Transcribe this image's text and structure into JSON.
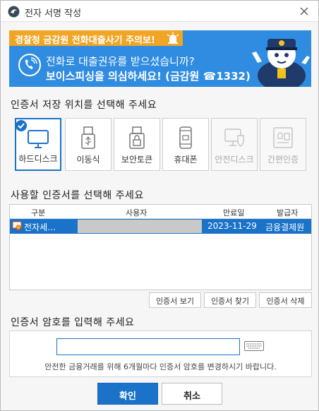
{
  "window": {
    "title": "전자 서명 작성"
  },
  "banner": {
    "alert": "경찰청 금감원 전화대출사기 주의보!",
    "line1": "전화로 대출권유를 받으셨습니까?",
    "line2": "보이스피싱을 의심하세요! (금감원 ☎1332)"
  },
  "storage": {
    "title": "인증서 저장 위치를 선택해 주세요",
    "items": [
      {
        "label": "하드디스크",
        "icon": "monitor-icon",
        "state": "selected"
      },
      {
        "label": "이동식",
        "icon": "usb-icon",
        "state": "enabled"
      },
      {
        "label": "보안토큰",
        "icon": "lock-token-icon",
        "state": "enabled"
      },
      {
        "label": "휴대폰",
        "icon": "phone-icon",
        "state": "enabled"
      },
      {
        "label": "안전디스크",
        "icon": "secure-disk-icon",
        "state": "disabled"
      },
      {
        "label": "간편인증",
        "icon": "simple-auth-icon",
        "state": "disabled"
      }
    ]
  },
  "certs": {
    "title": "사용할 인증서를 선택해 주세요",
    "columns": [
      "구분",
      "사용자",
      "만료일",
      "발급자"
    ],
    "rows": [
      {
        "type": "전자세…",
        "user": "",
        "expiry": "2023-11-29",
        "issuer": "금융결제원"
      }
    ],
    "buttons": {
      "view": "인증서 보기",
      "find": "인증서 찾기",
      "delete": "인증서 삭제"
    }
  },
  "password": {
    "title": "인증서 암호를 입력해 주세요",
    "value": "",
    "note": "안전한 금융거래를 위해 6개월마다 인증서 암호를 변경하시기 바랍니다."
  },
  "actions": {
    "ok": "확인",
    "cancel": "취소"
  },
  "colors": {
    "accent": "#1a73c8",
    "banner": "#2f8ce0",
    "alert": "#f0a524"
  }
}
